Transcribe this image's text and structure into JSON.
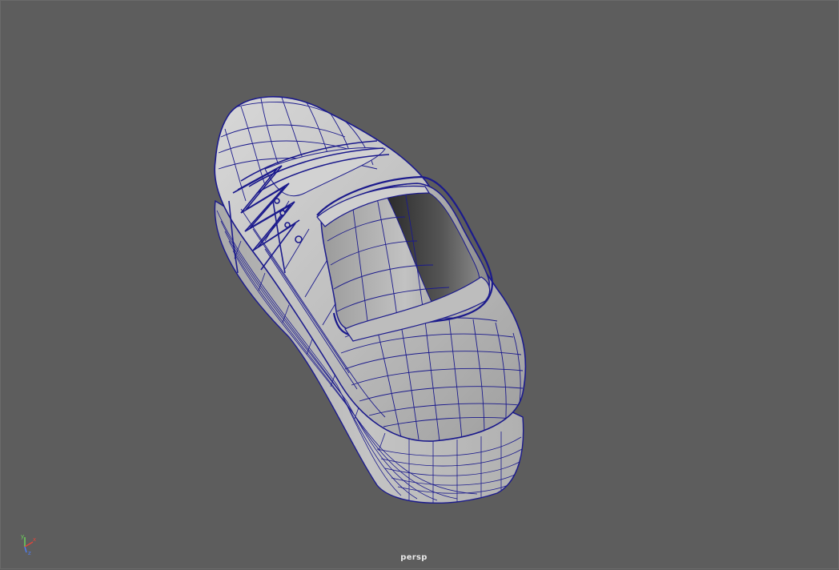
{
  "viewport": {
    "camera_name": "persp",
    "background_color": "#5d5d5d",
    "wireframe_color": "#1b1a8c",
    "shaded_color": "#c9c9c9",
    "object": "sneaker-model"
  },
  "axis_gizmo": {
    "x_label": "x",
    "y_label": "y",
    "z_label": "z",
    "x_color": "#e0453a",
    "y_color": "#6cd35b",
    "z_color": "#4f7df2"
  }
}
